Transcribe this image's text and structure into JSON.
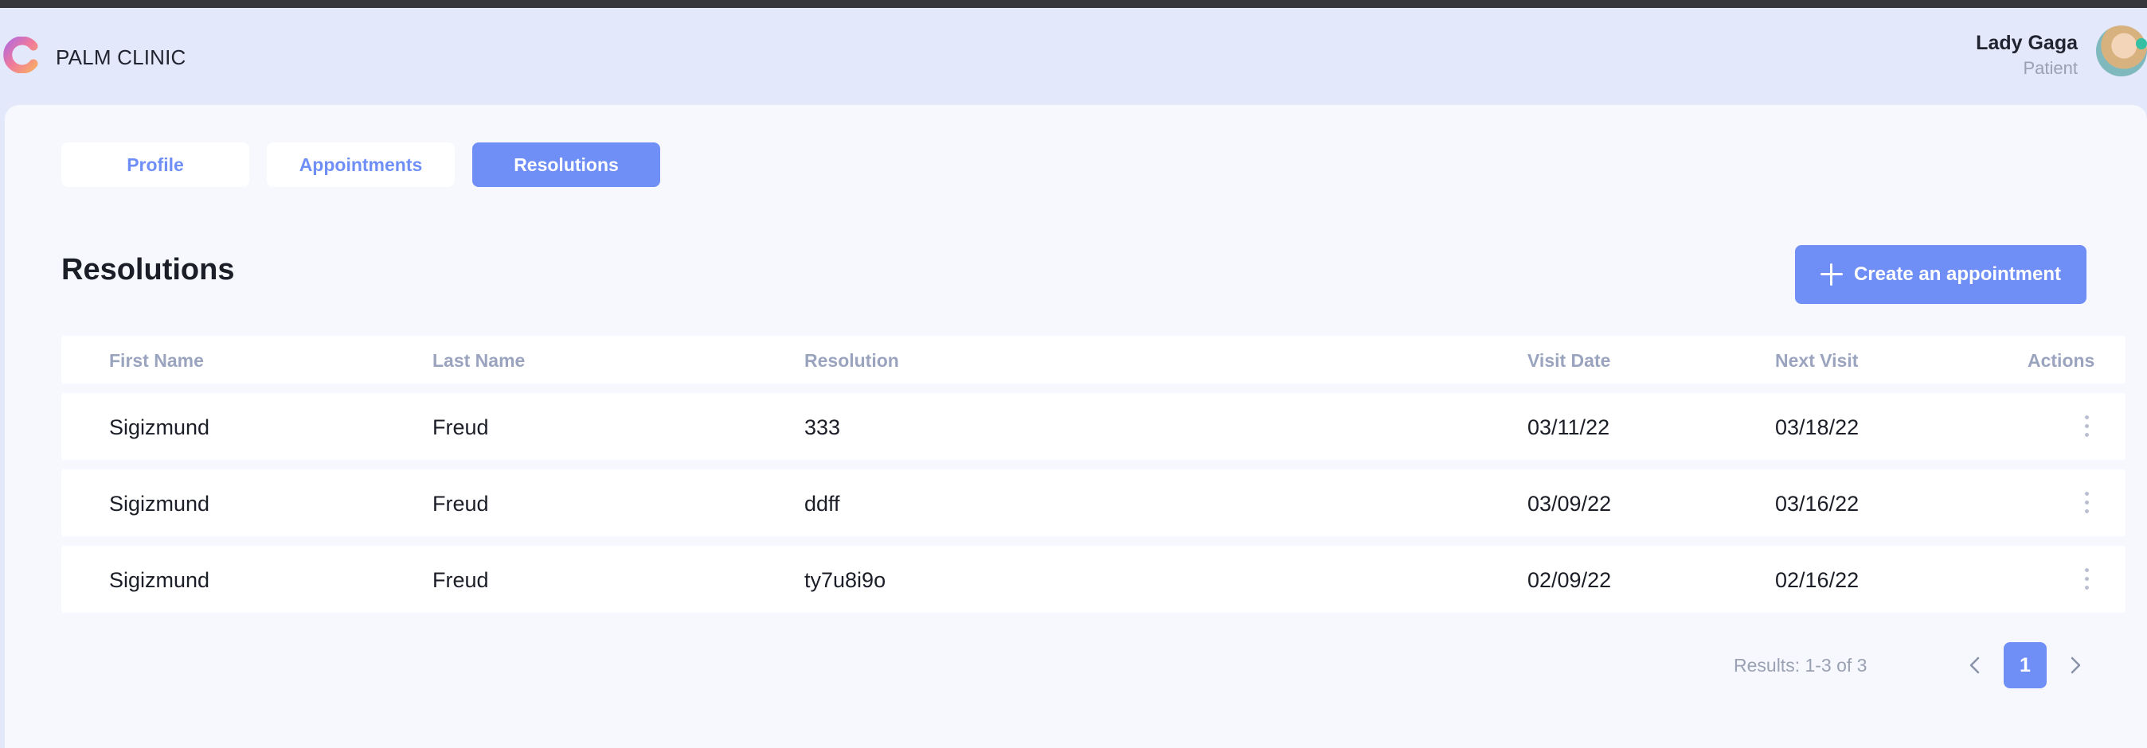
{
  "app": {
    "brand": "PALM CLINIC"
  },
  "user": {
    "name": "Lady Gaga",
    "role": "Patient"
  },
  "tabs": [
    {
      "label": "Profile"
    },
    {
      "label": "Appointments"
    },
    {
      "label": "Resolutions",
      "active": true
    }
  ],
  "section": {
    "title": "Resolutions"
  },
  "create_button": {
    "label": "Create an appointment"
  },
  "table": {
    "headers": {
      "first_name": "First Name",
      "last_name": "Last Name",
      "resolution": "Resolution",
      "visit_date": "Visit Date",
      "next_visit": "Next Visit",
      "actions": "Actions"
    },
    "rows": [
      {
        "first_name": "Sigizmund",
        "last_name": "Freud",
        "resolution": "333",
        "visit_date": "03/11/22",
        "next_visit": "03/18/22"
      },
      {
        "first_name": "Sigizmund",
        "last_name": "Freud",
        "resolution": "ddff",
        "visit_date": "03/09/22",
        "next_visit": "03/16/22"
      },
      {
        "first_name": "Sigizmund",
        "last_name": "Freud",
        "resolution": "ty7u8i9o",
        "visit_date": "02/09/22",
        "next_visit": "02/16/22"
      }
    ]
  },
  "pagination": {
    "results_text": "Results: 1-3 of 3",
    "current_page": "1"
  },
  "colors": {
    "accent": "#6f8ff7",
    "background": "#e3e9fb",
    "panel": "#f6f8fe"
  }
}
